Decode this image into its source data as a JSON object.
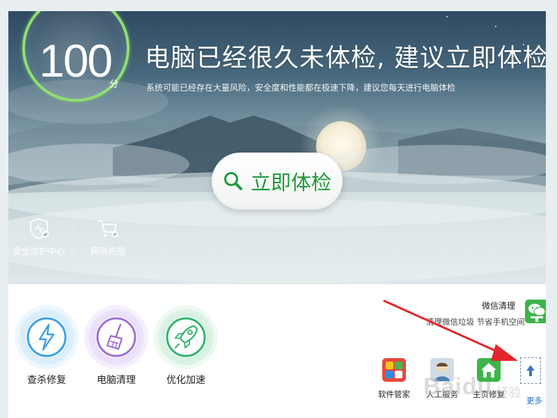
{
  "hero": {
    "score": "100",
    "score_unit": "分",
    "headline": "电脑已经很久未体检, 建议立即体检 !",
    "subline": "系统可能已经存在大量风险，安全度和性能都在极速下降，建议您每天进行电脑体检",
    "exam_button": {
      "label": "立即体检",
      "icon": "search-icon"
    },
    "shortcuts": [
      {
        "label": "安全防护中心",
        "icon": "shield-icon"
      },
      {
        "label": "网购先赔",
        "icon": "cart-icon"
      }
    ]
  },
  "tools": [
    {
      "label": "查杀修复",
      "icon": "lightning-icon",
      "color": "#3aa0e8"
    },
    {
      "label": "电脑清理",
      "icon": "broom-icon",
      "color": "#9b6fd6"
    },
    {
      "label": "优化加速",
      "icon": "rocket-icon",
      "color": "#2fb56a"
    }
  ],
  "wechat": {
    "title": "微信清理",
    "desc": "清理微信垃圾 节省手机空间",
    "icon": "wechat-clean-icon"
  },
  "apps": [
    {
      "label": "软件管家",
      "icon": "software-manager-icon"
    },
    {
      "label": "人工服务",
      "icon": "support-person-icon"
    },
    {
      "label": "主页修复",
      "icon": "home-repair-icon"
    }
  ],
  "more_label": "更多",
  "watermark": {
    "main": "Baidu",
    "sub": "经验"
  },
  "colors": {
    "accent_green": "#1f9a3a",
    "ring_green": "#8fe070",
    "link_blue": "#2a6fd0",
    "arrow_red": "#e3262b"
  }
}
